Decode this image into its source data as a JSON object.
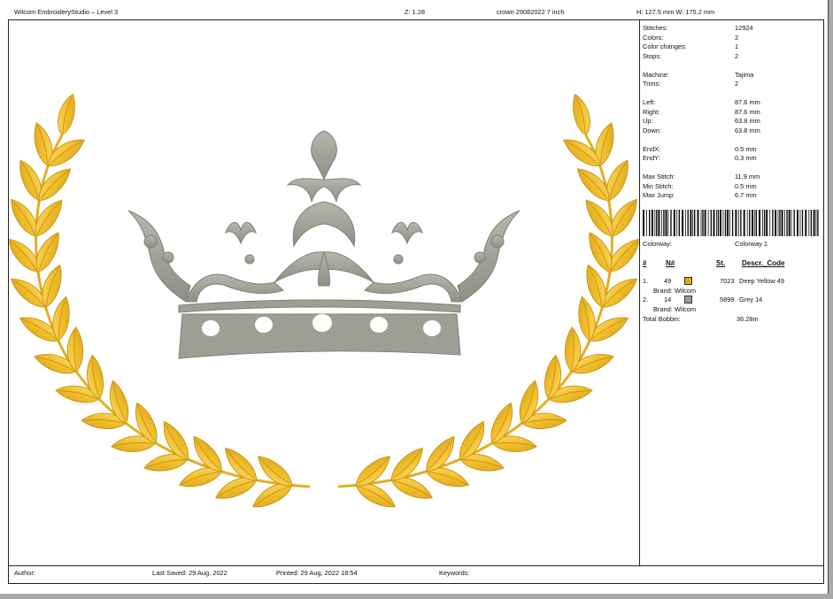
{
  "header": {
    "app_title": "Wilcom EmbroideryStudio – Level 3",
    "zoom": "Z: 1.28",
    "design_name": "crown 29082022 7 inch",
    "dimensions": "H: 127.5 mm   W: 175.2 mm"
  },
  "stats": [
    {
      "label": "Stitches:",
      "value": "12924"
    },
    {
      "label": "Colors:",
      "value": "2"
    },
    {
      "label": "Color changes:",
      "value": "1"
    },
    {
      "label": "Stops:",
      "value": "2"
    },
    {
      "label": "Machine:",
      "value": "Tajima"
    },
    {
      "label": "Trims:",
      "value": "2"
    },
    {
      "label": "Left:",
      "value": "87.6 mm"
    },
    {
      "label": "Right:",
      "value": "87.6 mm"
    },
    {
      "label": "Up:",
      "value": "63.8 mm"
    },
    {
      "label": "Down:",
      "value": "63.8 mm"
    },
    {
      "label": "EndX:",
      "value": "0.5 mm"
    },
    {
      "label": "EndY:",
      "value": "0.3 mm"
    },
    {
      "label": "Max Stitch:",
      "value": "11.9 mm"
    },
    {
      "label": "Min Stitch:",
      "value": "0.5 mm"
    },
    {
      "label": "Max Jump:",
      "value": "6.7 mm"
    }
  ],
  "colorway": {
    "label": "Colorway:",
    "value": "Colorway 1"
  },
  "thread_table": {
    "headers": [
      "#",
      "N#",
      "St.",
      "Descr._Code"
    ],
    "rows": [
      {
        "index": "1.",
        "number": "49",
        "color": "#e8a317",
        "stitches": "7023",
        "description": "Deep Yellow 49",
        "brand": "Brand: Wilcom"
      },
      {
        "index": "2.",
        "number": "14",
        "color": "#9a9a94",
        "stitches": "5899",
        "description": "Grey 14",
        "brand": "Brand: Wilcom"
      }
    ],
    "total_label": "Total Bobbin:",
    "total_value": "36.28m"
  },
  "footer": {
    "author": "Author:",
    "last_saved": "Last Saved: 29 Aug, 2022",
    "printed": "Printed: 29 Aug, 2022 18:54",
    "keywords": "Keywords:"
  },
  "colors": {
    "gold": "#f2c12e",
    "gold_shadow": "#d9a21a",
    "gold_highlight": "#fbe07a",
    "silver": "#9ea195",
    "silver_shadow": "#7f8276"
  },
  "icons": [
    "crown-embroidery",
    "laurel-wreath-embroidery",
    "barcode"
  ]
}
